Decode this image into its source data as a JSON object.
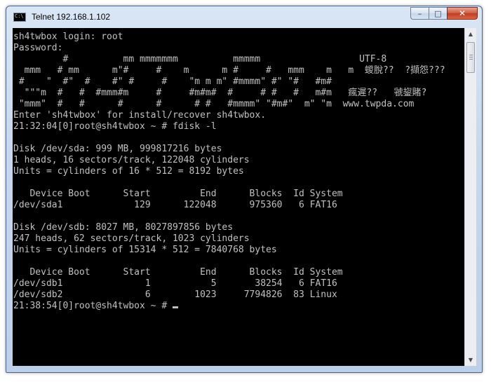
{
  "window": {
    "title": "Telnet 192.168.1.102",
    "icon_text": "C:\\",
    "minimize_icon": "minimize-icon",
    "maximize_icon": "maximize-icon",
    "close_icon": "close-icon"
  },
  "console": {
    "lines": [
      "sh4twbox login: root",
      "Password:",
      "         #          mm mmmmmmm          mmmmm                  UTF-8",
      "  mmm   # mm      m\"#     #    m      m #     #   mmm    m   m  蝬脫??  ?擷怨???",
      " #    \"  #\"  #    #\" #     #    \"m m m\" #mmmm\" #\" \"#   #m#",
      "  \"\"\"m  #   #  #mmm#m     #     #m#m#  #     # #   #   m#m   瘋遲??   虢鋆賭?",
      " \"mmm\"  #   #      #      #      # #   #mmmm\" \"#m#\"  m\" \"m  www.twpda.com",
      "Enter 'sh4twbox' for install/recover sh4twbox.",
      "21:32:04[0]root@sh4twbox ~ # fdisk -l",
      "",
      "Disk /dev/sda: 999 MB, 999817216 bytes",
      "1 heads, 16 sectors/track, 122048 cylinders",
      "Units = cylinders of 16 * 512 = 8192 bytes",
      "",
      "   Device Boot      Start         End      Blocks  Id System",
      "/dev/sda1             129      122048      975360   6 FAT16",
      "",
      "Disk /dev/sdb: 8027 MB, 8027897856 bytes",
      "247 heads, 62 sectors/track, 1023 cylinders",
      "Units = cylinders of 15314 * 512 = 7840768 bytes",
      "",
      "   Device Boot      Start         End      Blocks  Id System",
      "/dev/sdb1               1           5       38254   6 FAT16",
      "/dev/sdb2               6        1023     7794826  83 Linux",
      "21:38:54[0]root@sh4twbox ~ # "
    ]
  },
  "colors": {
    "console_bg": "#000000",
    "console_fg": "#c0c0c0"
  }
}
